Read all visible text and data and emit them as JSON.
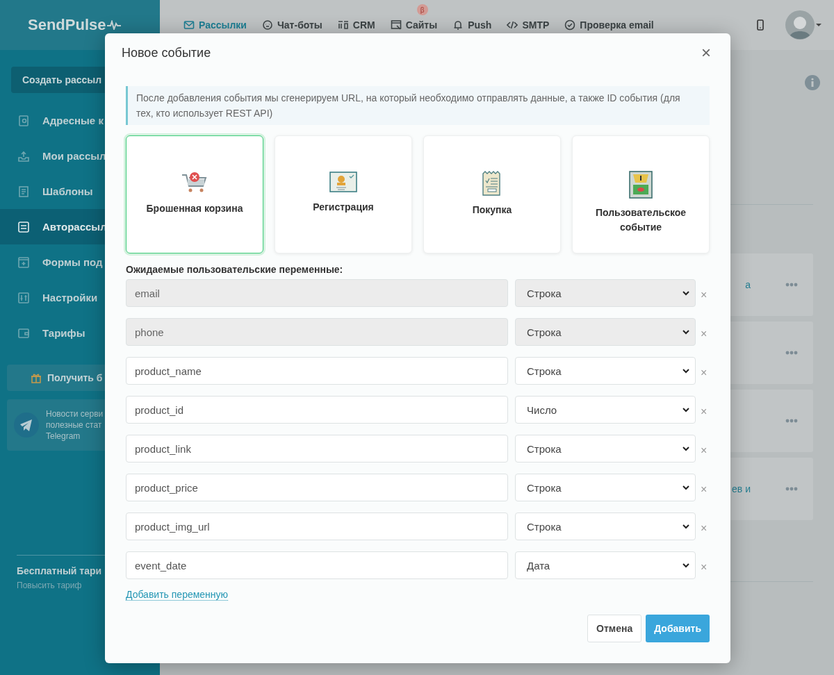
{
  "sidebar": {
    "logo": "SendPulse",
    "create_button": "Создать рассыл",
    "items": [
      {
        "label": "Адресные к",
        "selected": false
      },
      {
        "label": "Мои рассыл",
        "selected": false
      },
      {
        "label": "Шаблоны",
        "selected": false
      },
      {
        "label": "Авторассыл",
        "selected": true
      },
      {
        "label": "Формы под",
        "selected": false
      },
      {
        "label": "Настройки",
        "selected": false
      },
      {
        "label": "Тарифы",
        "selected": false
      }
    ],
    "bonus_button": "Получить б",
    "telegram": {
      "lines": [
        "Новости серви",
        "полезные стат",
        "Telegram"
      ]
    },
    "plan": {
      "title": "Бесплатный тари",
      "link": "Повысить тариф"
    }
  },
  "topbar": {
    "nav": [
      {
        "label": "Рассылки",
        "selected": true
      },
      {
        "label": "Чат-боты",
        "selected": false
      },
      {
        "label": "CRM",
        "selected": false
      },
      {
        "label": "Сайты",
        "selected": false,
        "badge": "β"
      },
      {
        "label": "Push",
        "selected": false
      },
      {
        "label": "SMTP",
        "selected": false
      },
      {
        "label": "Проверка email",
        "selected": false
      }
    ]
  },
  "background_list": [
    {
      "kind": "link",
      "link_text": "а"
    },
    {
      "kind": "plain"
    },
    {
      "kind": "plain"
    },
    {
      "kind": "link",
      "link_text": "ев и"
    }
  ],
  "modal": {
    "title": "Новое событие",
    "close": "×",
    "info": "После добавления события мы сгенерируем URL, на который необходимо отправлять данные, а также ID события (для тех, кто использует REST API)",
    "event_types": [
      {
        "label": "Брошенная корзина",
        "selected": true
      },
      {
        "label": "Регистрация",
        "selected": false
      },
      {
        "label": "Покупка",
        "selected": false
      },
      {
        "label": "Пользовательское событие",
        "selected": false
      }
    ],
    "variables_label": "Ожидаемые пользовательские переменные:",
    "variables": [
      {
        "name": "email",
        "type": "Строка",
        "disabled": true
      },
      {
        "name": "phone",
        "type": "Строка",
        "disabled": true
      },
      {
        "name": "product_name",
        "type": "Строка",
        "disabled": false
      },
      {
        "name": "product_id",
        "type": "Число",
        "disabled": false
      },
      {
        "name": "product_link",
        "type": "Строка",
        "disabled": false
      },
      {
        "name": "product_price",
        "type": "Строка",
        "disabled": false
      },
      {
        "name": "product_img_url",
        "type": "Строка",
        "disabled": false
      },
      {
        "name": "event_date",
        "type": "Дата",
        "disabled": false
      }
    ],
    "remove_mark": "×",
    "add_link": "Добавить переменную",
    "cancel_button": "Отмена",
    "submit_button": "Добавить"
  }
}
